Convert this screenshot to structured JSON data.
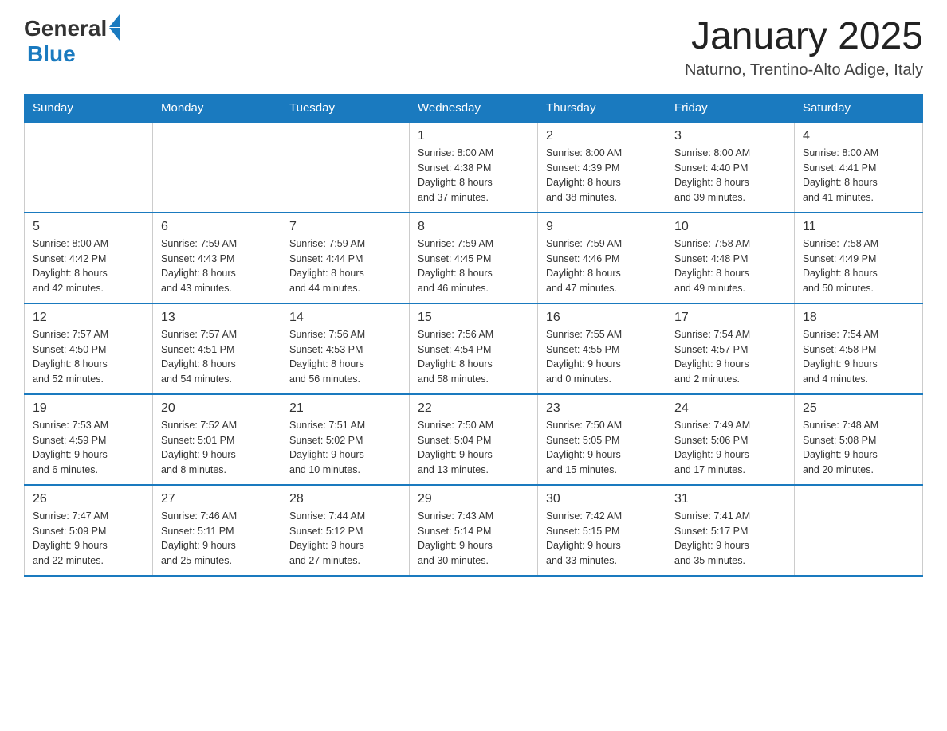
{
  "logo": {
    "text_general": "General",
    "text_blue": "Blue"
  },
  "title": "January 2025",
  "subtitle": "Naturno, Trentino-Alto Adige, Italy",
  "days_of_week": [
    "Sunday",
    "Monday",
    "Tuesday",
    "Wednesday",
    "Thursday",
    "Friday",
    "Saturday"
  ],
  "weeks": [
    [
      {
        "day": "",
        "info": ""
      },
      {
        "day": "",
        "info": ""
      },
      {
        "day": "",
        "info": ""
      },
      {
        "day": "1",
        "info": "Sunrise: 8:00 AM\nSunset: 4:38 PM\nDaylight: 8 hours\nand 37 minutes."
      },
      {
        "day": "2",
        "info": "Sunrise: 8:00 AM\nSunset: 4:39 PM\nDaylight: 8 hours\nand 38 minutes."
      },
      {
        "day": "3",
        "info": "Sunrise: 8:00 AM\nSunset: 4:40 PM\nDaylight: 8 hours\nand 39 minutes."
      },
      {
        "day": "4",
        "info": "Sunrise: 8:00 AM\nSunset: 4:41 PM\nDaylight: 8 hours\nand 41 minutes."
      }
    ],
    [
      {
        "day": "5",
        "info": "Sunrise: 8:00 AM\nSunset: 4:42 PM\nDaylight: 8 hours\nand 42 minutes."
      },
      {
        "day": "6",
        "info": "Sunrise: 7:59 AM\nSunset: 4:43 PM\nDaylight: 8 hours\nand 43 minutes."
      },
      {
        "day": "7",
        "info": "Sunrise: 7:59 AM\nSunset: 4:44 PM\nDaylight: 8 hours\nand 44 minutes."
      },
      {
        "day": "8",
        "info": "Sunrise: 7:59 AM\nSunset: 4:45 PM\nDaylight: 8 hours\nand 46 minutes."
      },
      {
        "day": "9",
        "info": "Sunrise: 7:59 AM\nSunset: 4:46 PM\nDaylight: 8 hours\nand 47 minutes."
      },
      {
        "day": "10",
        "info": "Sunrise: 7:58 AM\nSunset: 4:48 PM\nDaylight: 8 hours\nand 49 minutes."
      },
      {
        "day": "11",
        "info": "Sunrise: 7:58 AM\nSunset: 4:49 PM\nDaylight: 8 hours\nand 50 minutes."
      }
    ],
    [
      {
        "day": "12",
        "info": "Sunrise: 7:57 AM\nSunset: 4:50 PM\nDaylight: 8 hours\nand 52 minutes."
      },
      {
        "day": "13",
        "info": "Sunrise: 7:57 AM\nSunset: 4:51 PM\nDaylight: 8 hours\nand 54 minutes."
      },
      {
        "day": "14",
        "info": "Sunrise: 7:56 AM\nSunset: 4:53 PM\nDaylight: 8 hours\nand 56 minutes."
      },
      {
        "day": "15",
        "info": "Sunrise: 7:56 AM\nSunset: 4:54 PM\nDaylight: 8 hours\nand 58 minutes."
      },
      {
        "day": "16",
        "info": "Sunrise: 7:55 AM\nSunset: 4:55 PM\nDaylight: 9 hours\nand 0 minutes."
      },
      {
        "day": "17",
        "info": "Sunrise: 7:54 AM\nSunset: 4:57 PM\nDaylight: 9 hours\nand 2 minutes."
      },
      {
        "day": "18",
        "info": "Sunrise: 7:54 AM\nSunset: 4:58 PM\nDaylight: 9 hours\nand 4 minutes."
      }
    ],
    [
      {
        "day": "19",
        "info": "Sunrise: 7:53 AM\nSunset: 4:59 PM\nDaylight: 9 hours\nand 6 minutes."
      },
      {
        "day": "20",
        "info": "Sunrise: 7:52 AM\nSunset: 5:01 PM\nDaylight: 9 hours\nand 8 minutes."
      },
      {
        "day": "21",
        "info": "Sunrise: 7:51 AM\nSunset: 5:02 PM\nDaylight: 9 hours\nand 10 minutes."
      },
      {
        "day": "22",
        "info": "Sunrise: 7:50 AM\nSunset: 5:04 PM\nDaylight: 9 hours\nand 13 minutes."
      },
      {
        "day": "23",
        "info": "Sunrise: 7:50 AM\nSunset: 5:05 PM\nDaylight: 9 hours\nand 15 minutes."
      },
      {
        "day": "24",
        "info": "Sunrise: 7:49 AM\nSunset: 5:06 PM\nDaylight: 9 hours\nand 17 minutes."
      },
      {
        "day": "25",
        "info": "Sunrise: 7:48 AM\nSunset: 5:08 PM\nDaylight: 9 hours\nand 20 minutes."
      }
    ],
    [
      {
        "day": "26",
        "info": "Sunrise: 7:47 AM\nSunset: 5:09 PM\nDaylight: 9 hours\nand 22 minutes."
      },
      {
        "day": "27",
        "info": "Sunrise: 7:46 AM\nSunset: 5:11 PM\nDaylight: 9 hours\nand 25 minutes."
      },
      {
        "day": "28",
        "info": "Sunrise: 7:44 AM\nSunset: 5:12 PM\nDaylight: 9 hours\nand 27 minutes."
      },
      {
        "day": "29",
        "info": "Sunrise: 7:43 AM\nSunset: 5:14 PM\nDaylight: 9 hours\nand 30 minutes."
      },
      {
        "day": "30",
        "info": "Sunrise: 7:42 AM\nSunset: 5:15 PM\nDaylight: 9 hours\nand 33 minutes."
      },
      {
        "day": "31",
        "info": "Sunrise: 7:41 AM\nSunset: 5:17 PM\nDaylight: 9 hours\nand 35 minutes."
      },
      {
        "day": "",
        "info": ""
      }
    ]
  ]
}
